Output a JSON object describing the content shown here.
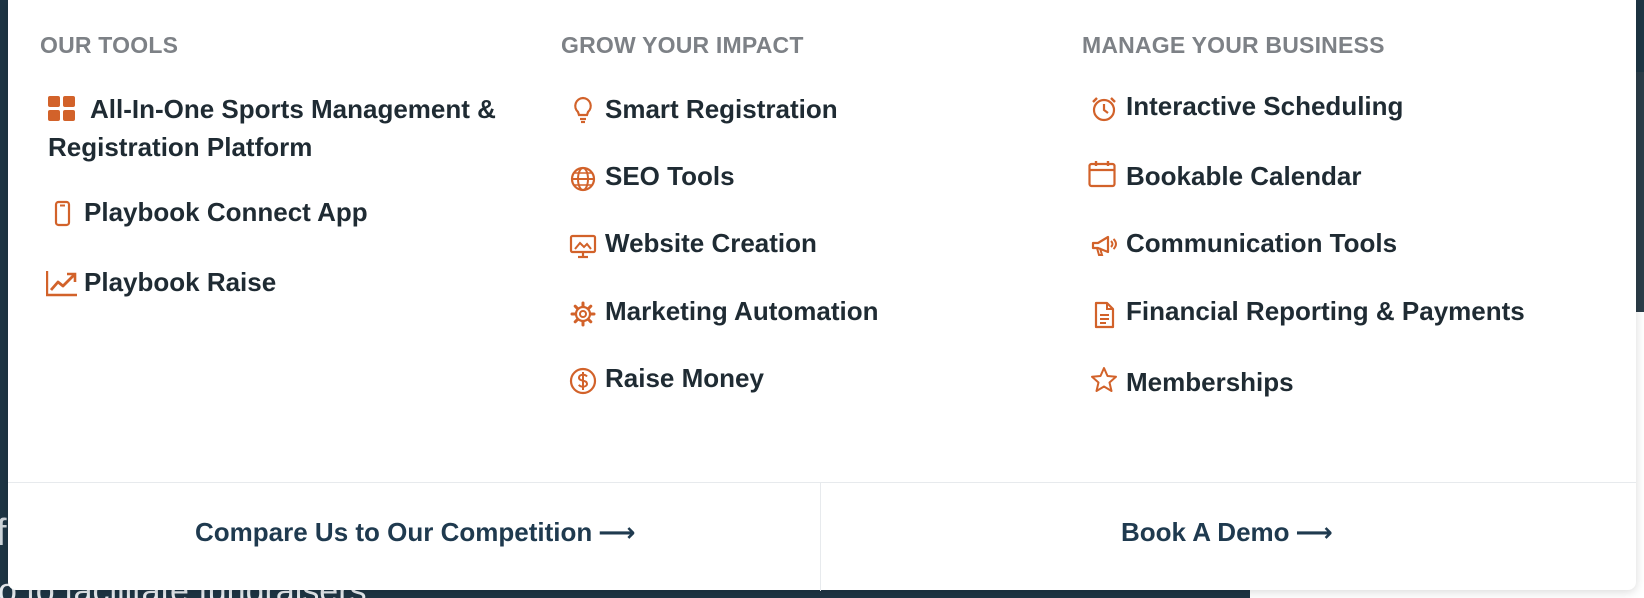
{
  "colors": {
    "accent": "#d2622a",
    "heading": "#7d8186",
    "text": "#1f2b33",
    "footer_link": "#1f3a4f"
  },
  "background": {
    "frag_left": "f",
    "caption": "o to facilitate fundraisers"
  },
  "columns": [
    {
      "heading": "OUR TOOLS",
      "items": [
        {
          "label": "All-In-One Sports Management & Registration Platform",
          "icon": "grid-icon"
        },
        {
          "label": "Playbook Connect App",
          "icon": "mobile-phone-icon"
        },
        {
          "label": "Playbook Raise",
          "icon": "trending-up-chart-icon"
        }
      ]
    },
    {
      "heading": "GROW YOUR IMPACT",
      "items": [
        {
          "label": "Smart Registration",
          "icon": "lightbulb-icon"
        },
        {
          "label": "SEO Tools",
          "icon": "globe-icon"
        },
        {
          "label": "Website Creation",
          "icon": "monitor-image-icon"
        },
        {
          "label": "Marketing Automation",
          "icon": "gear-icon"
        },
        {
          "label": "Raise Money",
          "icon": "dollar-circle-icon"
        }
      ]
    },
    {
      "heading": "MANAGE YOUR BUSINESS",
      "items": [
        {
          "label": "Interactive Scheduling",
          "icon": "alarm-clock-icon"
        },
        {
          "label": "Bookable Calendar",
          "icon": "calendar-icon"
        },
        {
          "label": "Communication Tools",
          "icon": "megaphone-icon"
        },
        {
          "label": "Financial Reporting & Payments",
          "icon": "document-icon"
        },
        {
          "label": "Memberships",
          "icon": "star-icon"
        }
      ]
    }
  ],
  "footer": {
    "compare": "Compare Us to Our Competition",
    "demo": "Book A Demo",
    "arrow": "⟶"
  }
}
